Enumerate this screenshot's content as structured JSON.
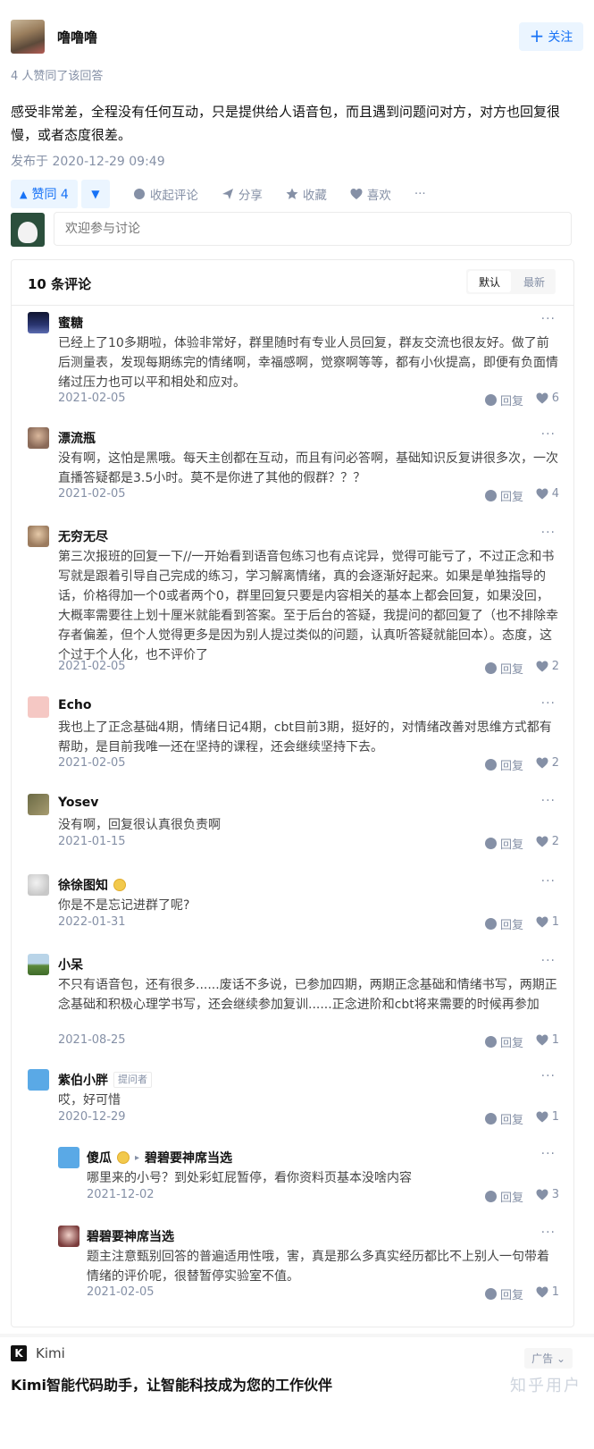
{
  "author": {
    "name": "噜噜噜",
    "follow_label": "关注"
  },
  "upvote_summary": "4 人赞同了该回答",
  "answer": {
    "text": "感受非常差，全程没有任何互动，只是提供给人语音包，而且遇到问题问对方，对方也回复很慢，或者态度很差。",
    "published": "发布于 2020-12-29 09:49"
  },
  "actions": {
    "upvote_label": "赞同 4",
    "collapse_comments": "收起评论",
    "share": "分享",
    "favorite": "收藏",
    "like": "喜欢",
    "more": "···"
  },
  "comment_input": {
    "placeholder": "欢迎参与讨论"
  },
  "comments_panel": {
    "title": "10 条评论",
    "sort": [
      "默认",
      "最新"
    ],
    "reply_label": "回复",
    "comments": [
      {
        "name": "蜜糖",
        "text": "已经上了10多期啦，体验非常好，群里随时有专业人员回复，群友交流也很友好。做了前后测量表，发现每期练完的情绪啊，幸福感啊，觉察啊等等，都有小伙提高，即便有负面情绪过压力也可以平和相处和应对。",
        "time": "2021-02-05",
        "likes": "6"
      },
      {
        "name": "漂流瓶",
        "text": "没有啊，这怕是黑哦。每天主创都在互动，而且有问必答啊，基础知识反复讲很多次，一次直播答疑都是3.5小时。莫不是你进了其他的假群？？？",
        "time": "2021-02-05",
        "likes": "4"
      },
      {
        "name": "无穷无尽",
        "text": "第三次报班的回复一下//一开始看到语音包练习也有点诧异，觉得可能亏了，不过正念和书写就是跟着引导自己完成的练习，学习解离情绪，真的会逐渐好起来。如果是单独指导的话，价格得加一个0或者两个0，群里回复只要是内容相关的基本上都会回复，如果没回，大概率需要往上划十厘米就能看到答案。至于后台的答疑，我提问的都回复了（也不排除幸存者偏差，但个人觉得更多是因为别人提过类似的问题，认真听答疑就能回本）。态度，这个过于个人化，也不评价了",
        "time": "2021-02-05",
        "likes": "2"
      },
      {
        "name": "Echo",
        "text": "我也上了正念基础4期，情绪日记4期，cbt目前3期，挺好的，对情绪改善对思维方式都有帮助，是目前我唯一还在坚持的课程，还会继续坚持下去。",
        "time": "2021-02-05",
        "likes": "2"
      },
      {
        "name": "Yosev",
        "text": "没有啊，回复很认真很负责啊",
        "time": "2021-01-15",
        "likes": "2"
      },
      {
        "name": "徐徐图知",
        "text": "你是不是忘记进群了呢?",
        "time": "2022-01-31",
        "likes": "1"
      },
      {
        "name": "小呆",
        "text": "不只有语音包，还有很多......废话不多说，已参加四期，两期正念基础和情绪书写，两期正念基础和积极心理学书写，还会继续参加复训......正念进阶和cbt将来需要的时候再参加",
        "time": "2021-08-25",
        "likes": "1"
      },
      {
        "name": "紫伯小胖",
        "tag": "提问者",
        "text": "哎，好可惜",
        "time": "2020-12-29",
        "likes": "1"
      },
      {
        "name": "傻瓜",
        "reply_to": "碧碧要神席当选",
        "text": "哪里来的小号？到处彩虹屁暂停，看你资料页基本没啥内容",
        "time": "2021-12-02",
        "likes": "3"
      },
      {
        "name": "碧碧要神席当选",
        "text": "题主注意甄别回答的普遍适用性哦，害，真是那么多真实经历都比不上别人一句带着情绪的评价呢，很替暂停实验室不值。",
        "time": "2021-02-05",
        "likes": "1"
      }
    ]
  },
  "ad": {
    "logo_letter": "K",
    "brand": "Kimi",
    "tag": "广告",
    "title": "Kimi智能代码助手，让智能科技成为您的工作伙伴",
    "watermark": "知乎用户"
  },
  "colors": {
    "accent": "#1772f6",
    "accent_bg": "#ebf5ff",
    "meta": "#8590a6"
  }
}
